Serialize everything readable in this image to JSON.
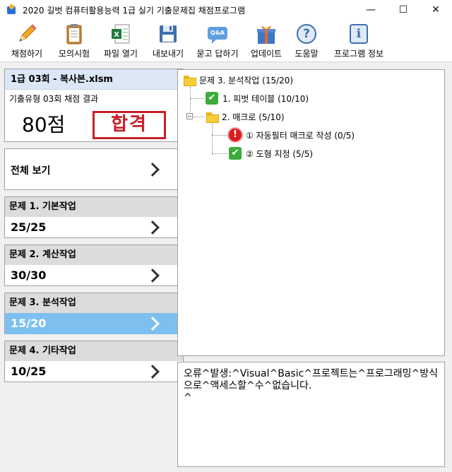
{
  "window": {
    "title": "2020 길벗 컴퓨터활용능력 1급 실기 기출문제집 채점프로그램",
    "min_glyph": "—",
    "max_glyph": "☐",
    "close_glyph": "✕"
  },
  "toolbar": {
    "items": [
      {
        "label": "채점하기",
        "icon": "pencil-icon"
      },
      {
        "label": "모의시험",
        "icon": "clipboard-icon"
      },
      {
        "label": "파일 열기",
        "icon": "excel-file-icon"
      },
      {
        "label": "내보내기",
        "icon": "floppy-disk-icon"
      },
      {
        "label": "묻고 답하기",
        "icon": "qa-bubble-icon"
      },
      {
        "label": "업데이트",
        "icon": "gift-box-icon"
      },
      {
        "label": "도움말",
        "icon": "help-icon"
      },
      {
        "label": "프로그램 정보",
        "icon": "info-icon"
      }
    ],
    "qa_text": "Q&A",
    "help_glyph": "?",
    "info_glyph": "i"
  },
  "file_card": {
    "title": "1급 03회 - 복사본.xlsm",
    "subtitle": "기출유형 03회 채점 결과",
    "score": "80점",
    "stamp": "합격"
  },
  "nav": {
    "all_label": "전체 보기",
    "questions": [
      {
        "label": "문제 1. 기본작업",
        "score": "25/25",
        "active": false
      },
      {
        "label": "문제 2. 계산작업",
        "score": "30/30",
        "active": false
      },
      {
        "label": "문제 3. 분석작업",
        "score": "15/20",
        "active": true
      },
      {
        "label": "문제 4. 기타작업",
        "score": "10/25",
        "active": false
      }
    ]
  },
  "tree": {
    "root": "문제 3. 분석작업 (15/20)",
    "item1": "1. 피벗 테이블 (10/10)",
    "item2": "2. 매크로 (5/10)",
    "item2a": "① 자동필터 매크로 작성 (0/5)",
    "item2b": "② 도형 지정 (5/5)",
    "check_glyph": "✔",
    "error_glyph": "!",
    "expander_glyph": "−"
  },
  "message": {
    "text": "오류^발생:^Visual^Basic^프로젝트는^프로그래밍^방식으로^액세스할^수^없습니다.\n^"
  },
  "colors": {
    "active_tab": "#7dc0f0",
    "stamp_red": "#c8202a",
    "check_green": "#3aad3a",
    "error_red": "#d91c1c"
  }
}
